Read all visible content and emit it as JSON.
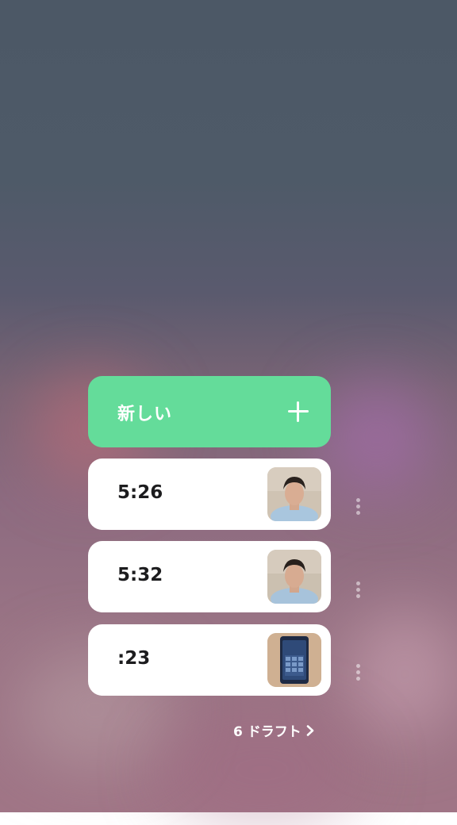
{
  "new_button": {
    "label": "新しい",
    "icon": "plus-icon"
  },
  "recordings": [
    {
      "time": "5:26",
      "thumbnail": "face-photo"
    },
    {
      "time": "5:32",
      "thumbnail": "face-photo"
    },
    {
      "time": ":23",
      "thumbnail": "phone-photo"
    }
  ],
  "drafts": {
    "label": "6 ドラフト",
    "icon": "chevron-right-icon"
  },
  "colors": {
    "accent": "#64dc9a",
    "card": "#ffffff",
    "text": "#1c1c1e"
  }
}
